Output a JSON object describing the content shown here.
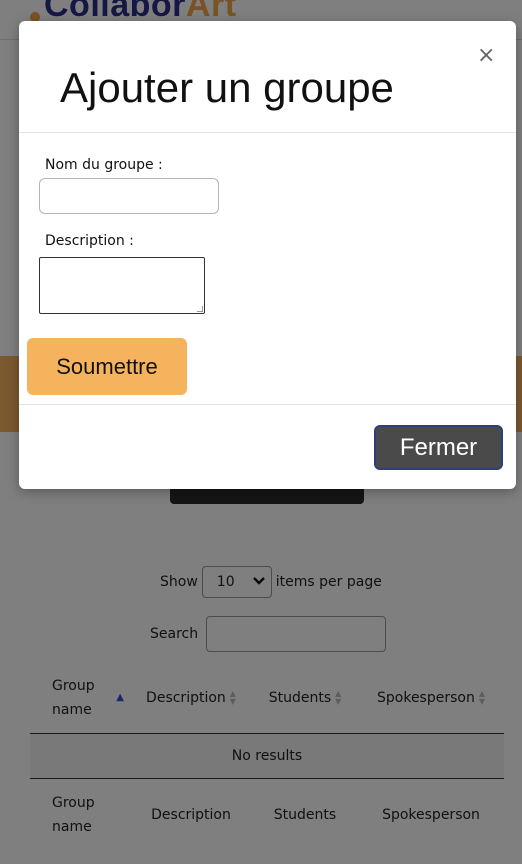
{
  "background": {
    "logo": {
      "part1": "Collabor",
      "part2": "Art"
    },
    "datatable": {
      "show_label": "Show",
      "page_size_value": "10",
      "items_per_page_label": "items per page",
      "search_label": "Search",
      "columns": [
        "Group name",
        "Description",
        "Students",
        "Spokesperson"
      ],
      "empty_message": "No results"
    }
  },
  "modal": {
    "title": "Ajouter un groupe",
    "close_icon": "×",
    "fields": {
      "name_label": "Nom du groupe :",
      "name_value": "",
      "description_label": "Description :",
      "description_value": ""
    },
    "submit_label": "Soumettre",
    "footer_close_label": "Fermer"
  },
  "colors": {
    "accent_orange": "#f6b35e",
    "brand_blue": "#2b2f8a",
    "close_button": "#4a4a4a",
    "overlay": "rgba(0,0,0,0.5)"
  }
}
